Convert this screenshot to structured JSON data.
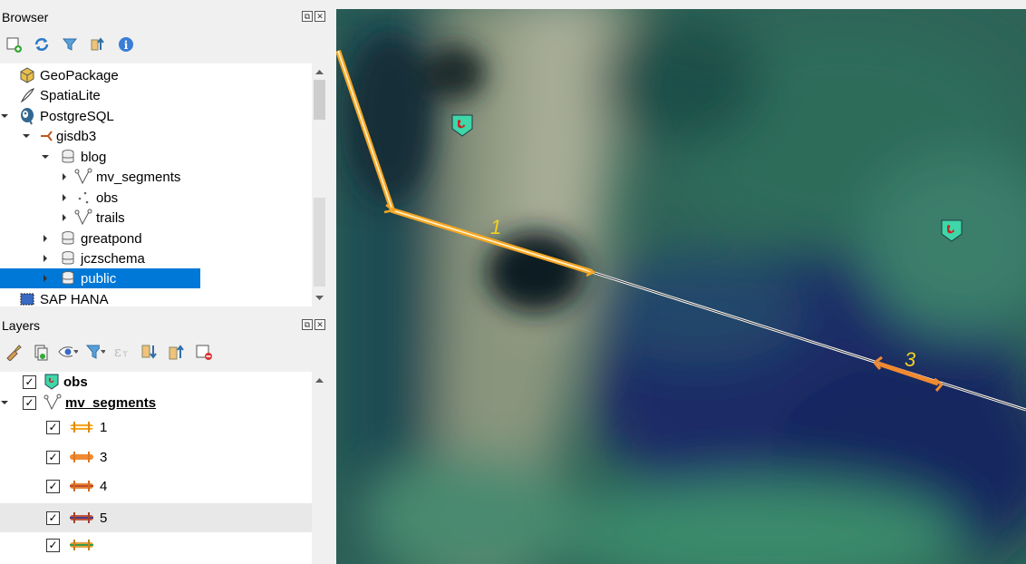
{
  "browser": {
    "title": "Browser",
    "float_btn": "⧉",
    "close_btn": "✕",
    "toolbar": [
      "add-layer-icon",
      "refresh-icon",
      "filter-icon",
      "collapse-icon",
      "info-icon"
    ],
    "items": [
      {
        "label": "GeoPackage",
        "icon": "geopackage-icon"
      },
      {
        "label": "SpatiaLite",
        "icon": "spatialite-icon"
      },
      {
        "label": "PostgreSQL",
        "icon": "postgresql-icon"
      },
      {
        "label": "gisdb3",
        "icon": "connection-icon"
      },
      {
        "label": "blog",
        "icon": "schema-icon"
      },
      {
        "label": "mv_segments",
        "icon": "line-layer-icon"
      },
      {
        "label": "obs",
        "icon": "point-layer-icon"
      },
      {
        "label": "trails",
        "icon": "line-layer-icon"
      },
      {
        "label": "greatpond",
        "icon": "schema-icon"
      },
      {
        "label": "jczschema",
        "icon": "schema-icon"
      },
      {
        "label": "public",
        "icon": "schema-icon"
      },
      {
        "label": "SAP HANA",
        "icon": "hana-icon"
      }
    ]
  },
  "layers": {
    "title": "Layers",
    "float_btn": "⧉",
    "close_btn": "✕",
    "toolbar": [
      "style-icon",
      "add-group-icon",
      "visibility-icon",
      "filter-legend-icon",
      "expression-filter-icon",
      "expand-all-icon",
      "collapse-all-icon",
      "remove-layer-icon"
    ],
    "items": [
      {
        "label": "obs",
        "checked": "✓"
      },
      {
        "label": "mv_segments",
        "checked": "✓"
      },
      {
        "label": "1",
        "checked": "✓",
        "color": "#f5a623"
      },
      {
        "label": "3",
        "checked": "✓",
        "color": "#f08a30"
      },
      {
        "label": "4",
        "checked": "✓",
        "color": "#e8852f"
      },
      {
        "label": "5",
        "checked": "✓",
        "color": "#c2583a"
      },
      {
        "label": "",
        "checked": "✓",
        "color": "#e8a03a"
      }
    ]
  },
  "map": {
    "labels": [
      "1",
      "3"
    ],
    "accent": "#f5a623"
  }
}
